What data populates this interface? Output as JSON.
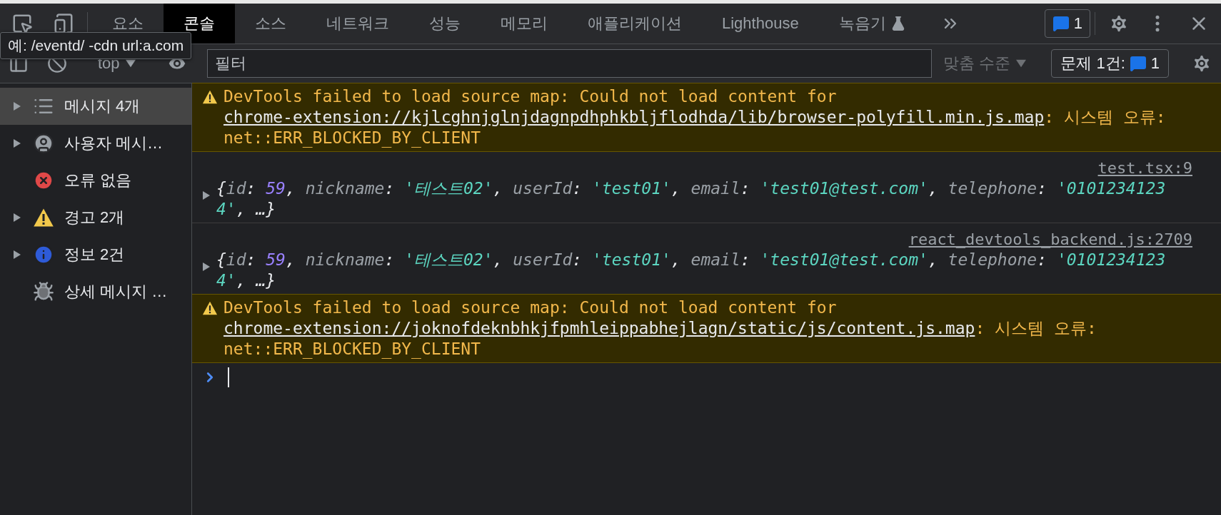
{
  "tabs": [
    {
      "label": "요소",
      "selected": false,
      "experimental": false
    },
    {
      "label": "콘솔",
      "selected": true,
      "experimental": false
    },
    {
      "label": "소스",
      "selected": false,
      "experimental": false
    },
    {
      "label": "네트워크",
      "selected": false,
      "experimental": false
    },
    {
      "label": "성능",
      "selected": false,
      "experimental": false
    },
    {
      "label": "메모리",
      "selected": false,
      "experimental": false
    },
    {
      "label": "애플리케이션",
      "selected": false,
      "experimental": false
    },
    {
      "label": "Lighthouse",
      "selected": false,
      "experimental": false
    },
    {
      "label": "녹음기",
      "selected": false,
      "experimental": true
    }
  ],
  "issues_badge": {
    "count": "1"
  },
  "tooltip": {
    "text": "예: /eventd/ -cdn url:a.com"
  },
  "console_toolbar": {
    "context": "top",
    "filter": {
      "placeholder": "필터"
    },
    "levels": {
      "label": "맞춤 수준",
      "disabled": true
    },
    "issues": {
      "label": "문제 1건:",
      "count": "1"
    }
  },
  "sidebar": {
    "items": [
      {
        "label": "메시지 4개",
        "kind": "list",
        "expandable": true,
        "selected": true
      },
      {
        "label": "사용자 메시…",
        "kind": "user",
        "expandable": true,
        "selected": false
      },
      {
        "label": "오류 없음",
        "kind": "error",
        "expandable": false,
        "selected": false
      },
      {
        "label": "경고 2개",
        "kind": "warning",
        "expandable": true,
        "selected": false
      },
      {
        "label": "정보 2건",
        "kind": "info",
        "expandable": true,
        "selected": false
      },
      {
        "label": "상세 메시지 …",
        "kind": "bug",
        "expandable": false,
        "selected": false
      }
    ]
  },
  "messages": [
    {
      "kind": "warning",
      "text": "DevTools failed to load source map: Could not load content for ",
      "link": "chrome-extension://kjlcghnjglnjdagnpdhphkbljflodhda/lib/browser-polyfill.min.js.map",
      "suffix": ": 시스템 오류: net::ERR_BLOCKED_BY_CLIENT"
    },
    {
      "kind": "log",
      "source": "test.tsx:9",
      "tokens": [
        {
          "kind": "punct",
          "text": "{"
        },
        {
          "kind": "key",
          "text": "id"
        },
        {
          "kind": "punct",
          "text": ": "
        },
        {
          "kind": "number",
          "text": "59"
        },
        {
          "kind": "punct",
          "text": ", "
        },
        {
          "kind": "key",
          "text": "nickname"
        },
        {
          "kind": "punct",
          "text": ": "
        },
        {
          "kind": "string",
          "text": "'테스트02'"
        },
        {
          "kind": "punct",
          "text": ", "
        },
        {
          "kind": "key",
          "text": "userId"
        },
        {
          "kind": "punct",
          "text": ": "
        },
        {
          "kind": "string",
          "text": "'test01'"
        },
        {
          "kind": "punct",
          "text": ", "
        },
        {
          "kind": "key",
          "text": "email"
        },
        {
          "kind": "punct",
          "text": ": "
        },
        {
          "kind": "string",
          "text": "'test01@test.com'"
        },
        {
          "kind": "punct",
          "text": ", "
        },
        {
          "kind": "key",
          "text": "telephone"
        },
        {
          "kind": "punct",
          "text": ": "
        },
        {
          "kind": "string",
          "text": "'01012341234'"
        },
        {
          "kind": "punct",
          "text": ", …}"
        }
      ]
    },
    {
      "kind": "log",
      "source": "react_devtools_backend.js:2709",
      "tokens": [
        {
          "kind": "punct",
          "text": "{"
        },
        {
          "kind": "key",
          "text": "id"
        },
        {
          "kind": "punct",
          "text": ": "
        },
        {
          "kind": "number",
          "text": "59"
        },
        {
          "kind": "punct",
          "text": ", "
        },
        {
          "kind": "key",
          "text": "nickname"
        },
        {
          "kind": "punct",
          "text": ": "
        },
        {
          "kind": "string",
          "text": "'테스트02'"
        },
        {
          "kind": "punct",
          "text": ", "
        },
        {
          "kind": "key",
          "text": "userId"
        },
        {
          "kind": "punct",
          "text": ": "
        },
        {
          "kind": "string",
          "text": "'test01'"
        },
        {
          "kind": "punct",
          "text": ", "
        },
        {
          "kind": "key",
          "text": "email"
        },
        {
          "kind": "punct",
          "text": ": "
        },
        {
          "kind": "string",
          "text": "'test01@test.com'"
        },
        {
          "kind": "punct",
          "text": ", "
        },
        {
          "kind": "key",
          "text": "telephone"
        },
        {
          "kind": "punct",
          "text": ": "
        },
        {
          "kind": "string",
          "text": "'01012341234'"
        },
        {
          "kind": "punct",
          "text": ", …}"
        }
      ]
    },
    {
      "kind": "warning",
      "text": "DevTools failed to load source map: Could not load content for ",
      "link": "chrome-extension://joknofdeknbhkjfpmhleippabhejlagn/static/js/content.js.map",
      "suffix": ": 시스템 오류: net::ERR_BLOCKED_BY_CLIENT"
    }
  ]
}
